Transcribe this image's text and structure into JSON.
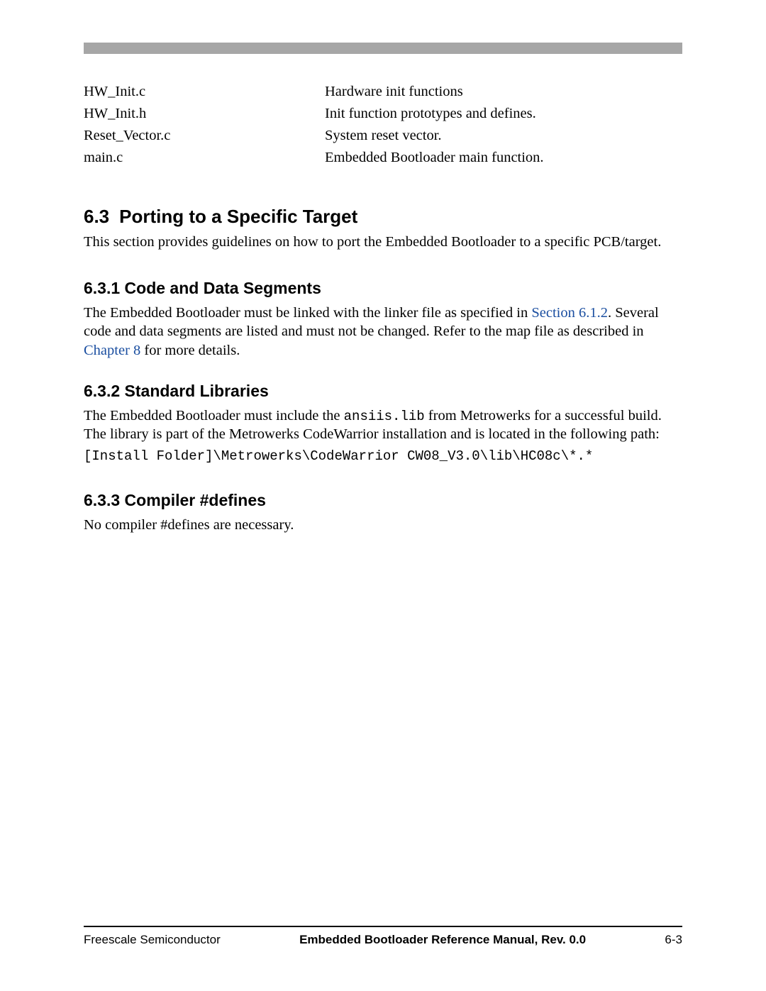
{
  "file_table": [
    {
      "file": "HW_Init.c",
      "desc": "Hardware init functions"
    },
    {
      "file": "HW_Init.h",
      "desc": "Init function prototypes and defines."
    },
    {
      "file": "Reset_Vector.c",
      "desc": "System reset vector."
    },
    {
      "file": "main.c",
      "desc": "Embedded Bootloader main function."
    }
  ],
  "sec63": {
    "num": "6.3",
    "title": "Porting to a Specific Target",
    "intro": "This section provides guidelines on how to port the Embedded Bootloader to a specific PCB/target."
  },
  "sec631": {
    "num": "6.3.1",
    "title": "Code and Data Segments",
    "p1a": "The Embedded Bootloader must be linked with the linker file as specified in ",
    "link1": "Section 6.1.2",
    "p1b": ". Several code and data segments are listed and must not be changed. Refer to the map file as described in ",
    "link2": "Chapter 8",
    "p1c": " for more details."
  },
  "sec632": {
    "num": "6.3.2",
    "title": "Standard Libraries",
    "p1a": "The Embedded Bootloader must include the ",
    "mono": "ansiis.lib",
    "p1b": " from Metrowerks for a successful build. The library is part of the Metrowerks CodeWarrior installation and is located in the following path:",
    "code_path": "[Install Folder]\\Metrowerks\\CodeWarrior CW08_V3.0\\lib\\HC08c\\*.*"
  },
  "sec633": {
    "num": "6.3.3",
    "title": "Compiler #defines",
    "p1": "No compiler #defines are necessary."
  },
  "footer": {
    "left": "Freescale Semiconductor",
    "center": "Embedded Bootloader Reference Manual, Rev. 0.0",
    "right": "6-3"
  }
}
